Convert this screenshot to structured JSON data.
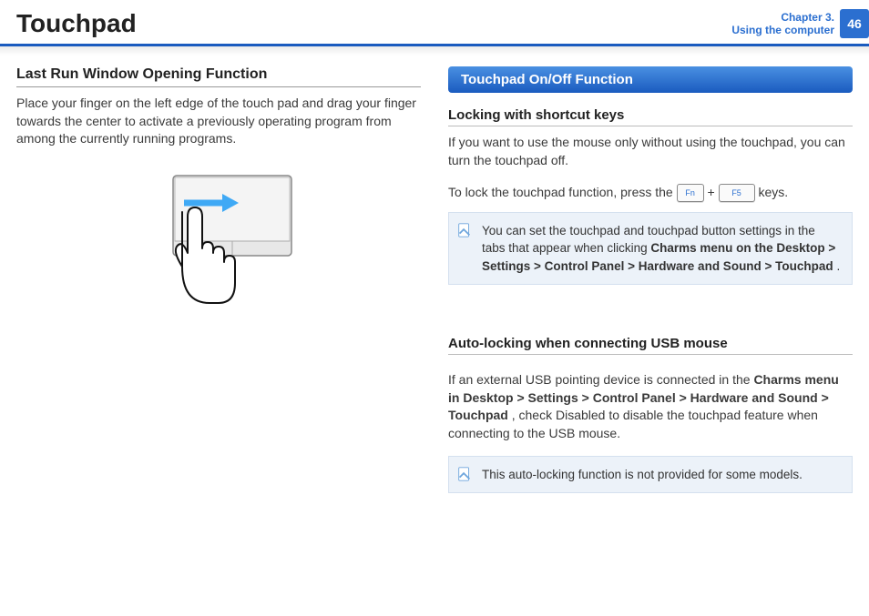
{
  "header": {
    "title": "Touchpad",
    "chapter_line1": "Chapter 3.",
    "chapter_line2": "Using the computer",
    "page": "46"
  },
  "left": {
    "section_title": "Last Run Window Opening Function",
    "paragraph": "Place your finger on the left edge of the touch pad and drag your finger towards the center to activate a previously operating program from among the currently running programs."
  },
  "right": {
    "pill": "Touchpad On/Off Function",
    "sub1_title": "Locking with shortcut keys",
    "sub1_p1": "If you want to use the mouse only without using the touchpad, you can turn the touchpad off.",
    "sub1_p2_a": "To lock the touchpad function, press the ",
    "key_fn": "Fn",
    "plus": " + ",
    "key_f5": "F5",
    "sub1_p2_b": " keys.",
    "note1_a": "You can set the touchpad and touchpad button settings in the tabs that appear when clicking ",
    "note1_path": "Charms menu on the Desktop > Settings > Control Panel > Hardware and Sound > Touchpad",
    "note1_b": ".",
    "sub2_title": "Auto-locking when connecting USB mouse",
    "sub2_p_a": "If an external USB pointing device is connected in the ",
    "sub2_path": "Charms menu in Desktop > Settings > Control Panel > Hardware and Sound > Touchpad",
    "sub2_p_b": ", check Disabled to disable the touchpad feature when connecting to the USB mouse.",
    "note2": "This auto-locking function is not provided for some models."
  }
}
